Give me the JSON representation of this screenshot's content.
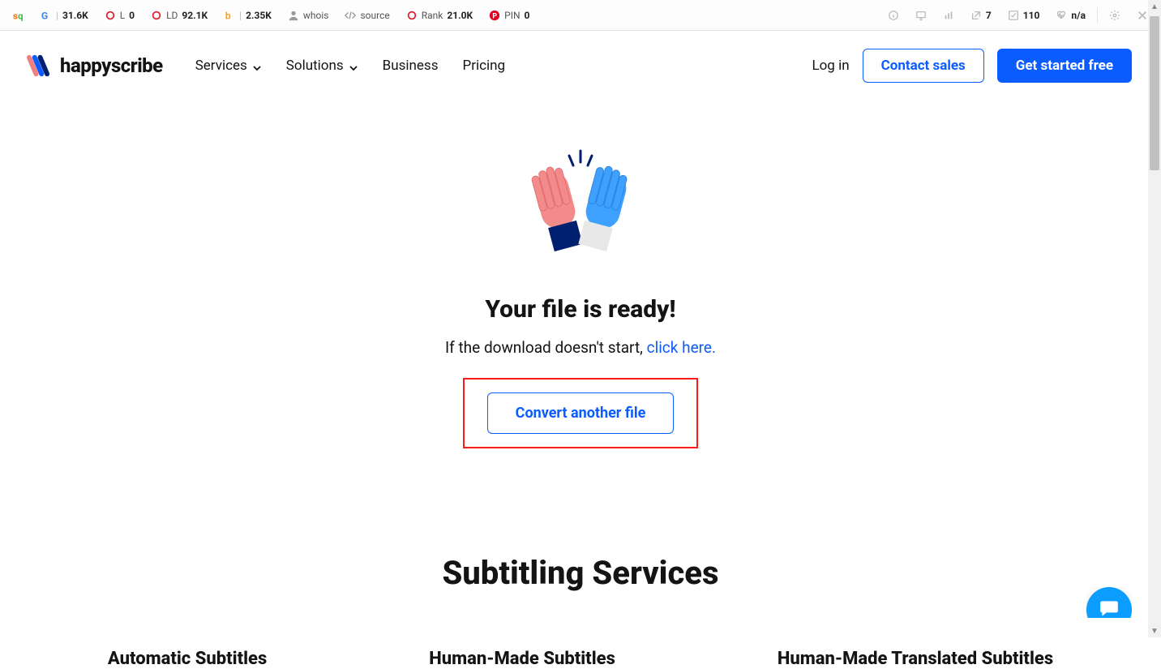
{
  "ext": {
    "left": [
      {
        "label": "",
        "value": "31.6K",
        "icon": "google"
      },
      {
        "label": "L",
        "value": "0",
        "icon": "red-circle"
      },
      {
        "label": "LD",
        "value": "92.1K",
        "icon": "red-circle"
      },
      {
        "label": "",
        "value": "2.35K",
        "icon": "bing"
      },
      {
        "label": "whois",
        "value": "",
        "icon": "user"
      },
      {
        "label": "source",
        "value": "",
        "icon": "code"
      },
      {
        "label": "Rank",
        "value": "21.0K",
        "icon": "red-circle"
      },
      {
        "label": "PIN",
        "value": "0",
        "icon": "pinterest"
      }
    ],
    "right": [
      {
        "label": "",
        "value": "",
        "icon": "info"
      },
      {
        "label": "",
        "value": "",
        "icon": "monitor"
      },
      {
        "label": "",
        "value": "",
        "icon": "chart"
      },
      {
        "label": "",
        "value": "7",
        "icon": "external"
      },
      {
        "label": "",
        "value": "110",
        "icon": "check"
      },
      {
        "label": "",
        "value": "n/a",
        "icon": "heart"
      }
    ]
  },
  "brand": "happyscribe",
  "nav": {
    "services": "Services",
    "solutions": "Solutions",
    "business": "Business",
    "pricing": "Pricing"
  },
  "header": {
    "login": "Log in",
    "contact": "Contact sales",
    "cta": "Get started free"
  },
  "main": {
    "headline": "Your file is ready!",
    "sub_prefix": "If the download doesn't start, ",
    "sub_link": "click here.",
    "convert_btn": "Convert another file"
  },
  "section": {
    "title": "Subtitling Services",
    "cards": [
      "Automatic Subtitles",
      "Human-Made Subtitles",
      "Human-Made Translated Subtitles"
    ]
  }
}
